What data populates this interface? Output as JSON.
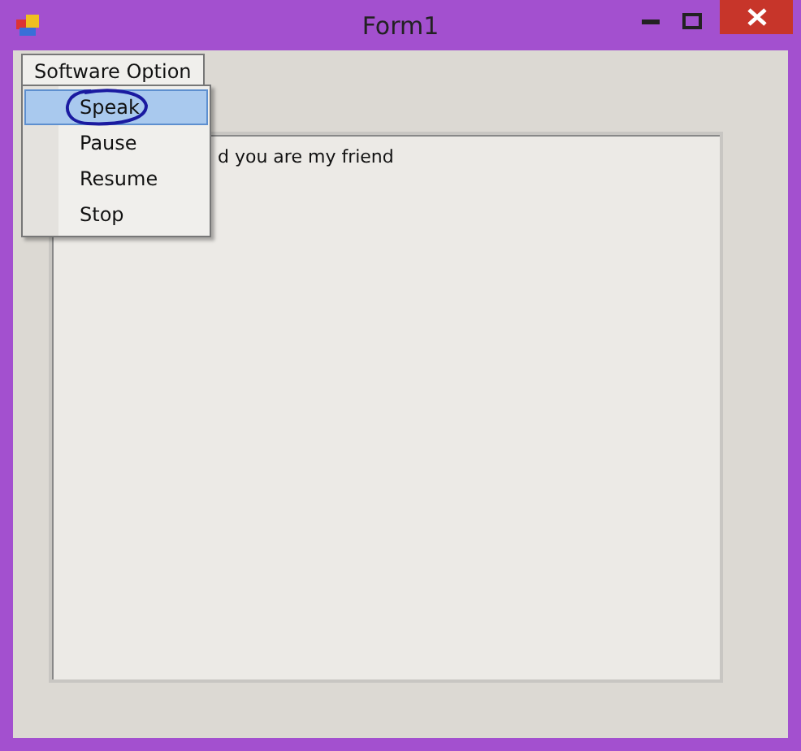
{
  "window": {
    "title": "Form1"
  },
  "menu": {
    "label": "Software Option",
    "expanded": true,
    "items": [
      {
        "label": "Speak",
        "selected": true,
        "circled": true
      },
      {
        "label": "Pause",
        "selected": false,
        "circled": false
      },
      {
        "label": "Resume",
        "selected": false,
        "circled": false
      },
      {
        "label": "Stop",
        "selected": false,
        "circled": false
      }
    ]
  },
  "textbox": {
    "value": "d you are my friend"
  }
}
